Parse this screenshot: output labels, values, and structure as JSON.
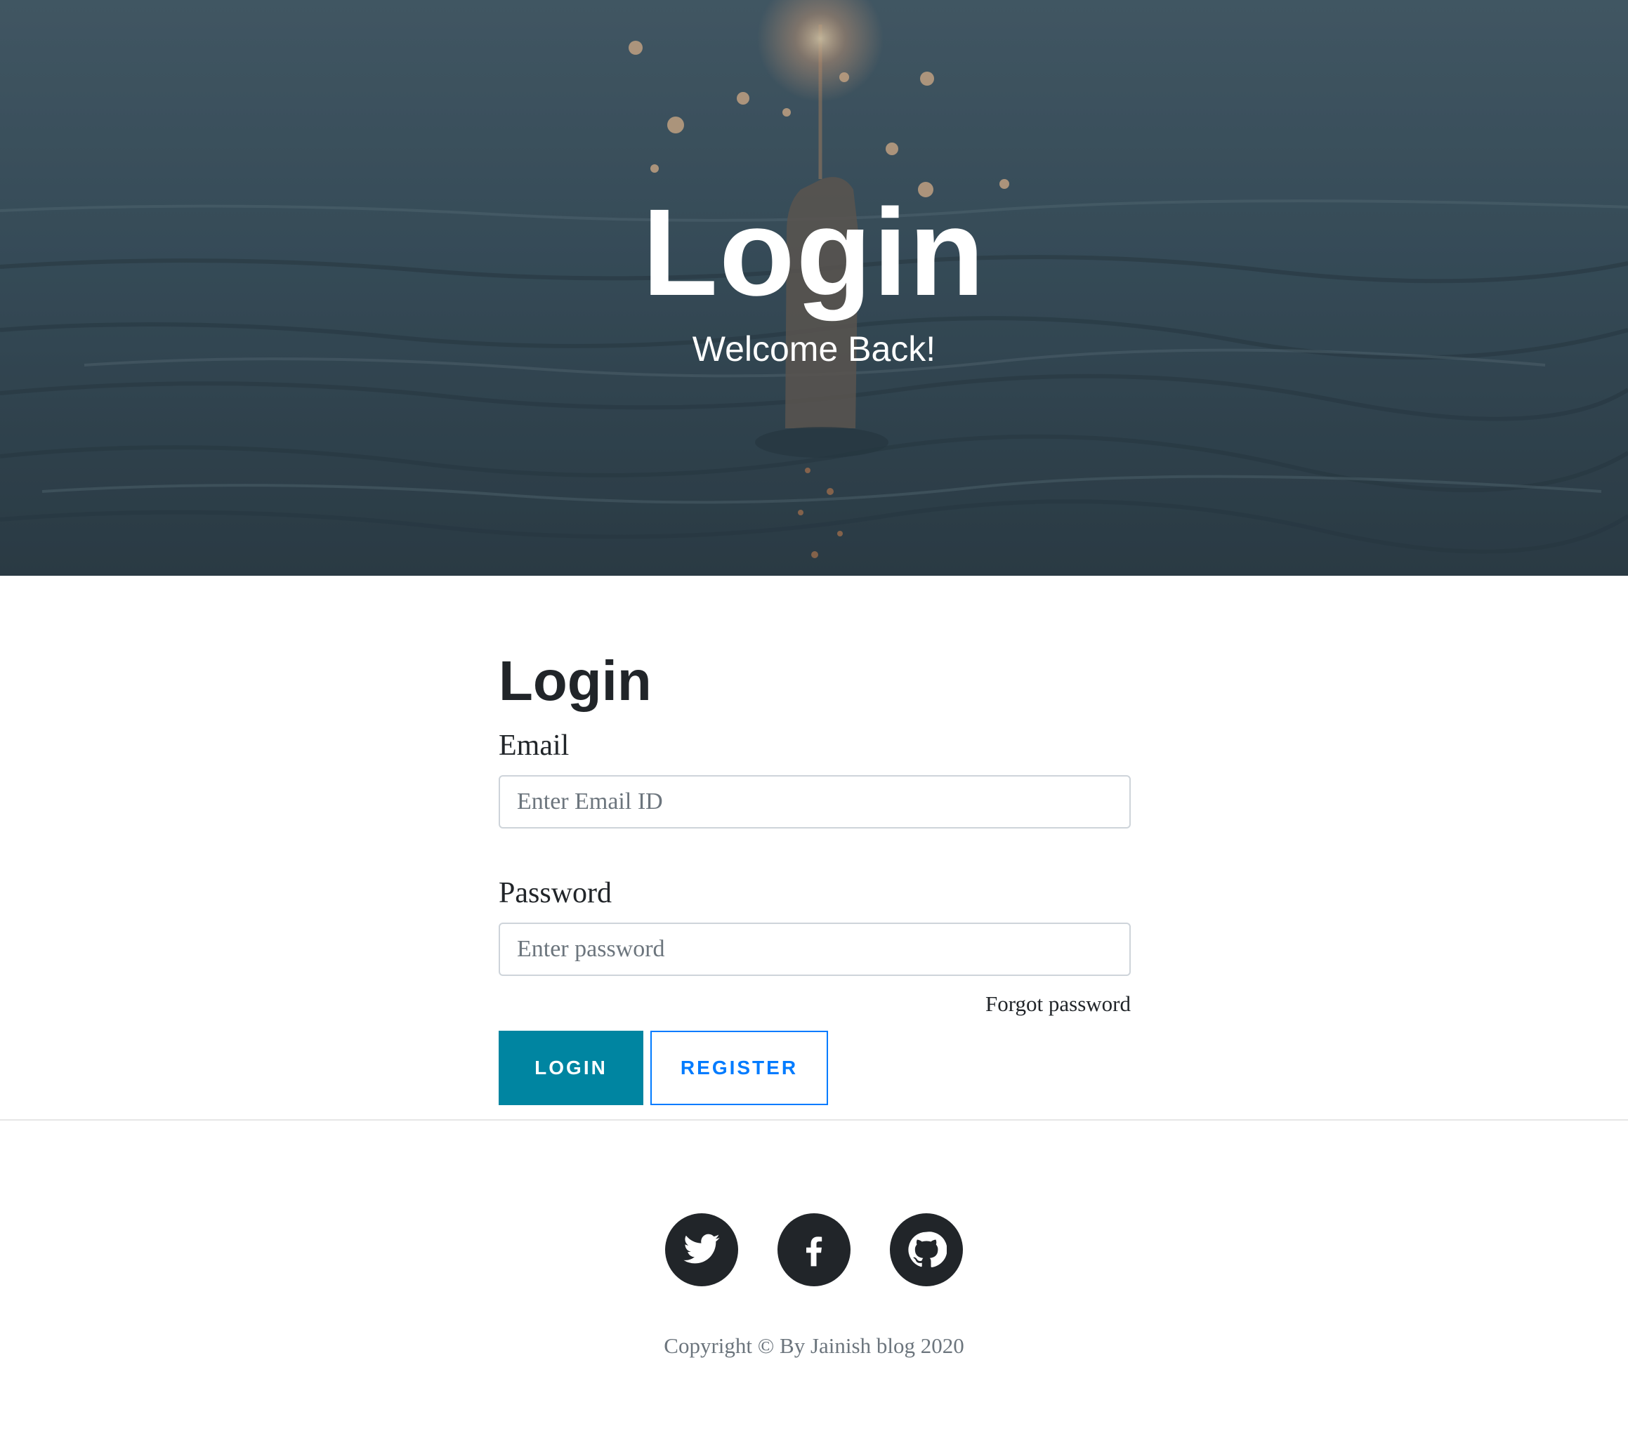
{
  "hero": {
    "heading": "Login",
    "subheading": "Welcome Back!"
  },
  "form": {
    "title": "Login",
    "email": {
      "label": "Email",
      "placeholder": "Enter Email ID",
      "value": ""
    },
    "password": {
      "label": "Password",
      "placeholder": "Enter password",
      "value": ""
    },
    "forgot_label": "Forgot password",
    "login_label": "LOGIN",
    "register_label": "REGISTER"
  },
  "footer": {
    "social": [
      {
        "icon": "twitter-icon"
      },
      {
        "icon": "facebook-icon"
      },
      {
        "icon": "github-icon"
      }
    ],
    "copyright": "Copyright © By Jainish blog 2020"
  },
  "colors": {
    "primary_button": "#0085a1",
    "register_outline": "#007bff",
    "social_circle": "#212529",
    "hero_overlay": "#3f5563"
  }
}
